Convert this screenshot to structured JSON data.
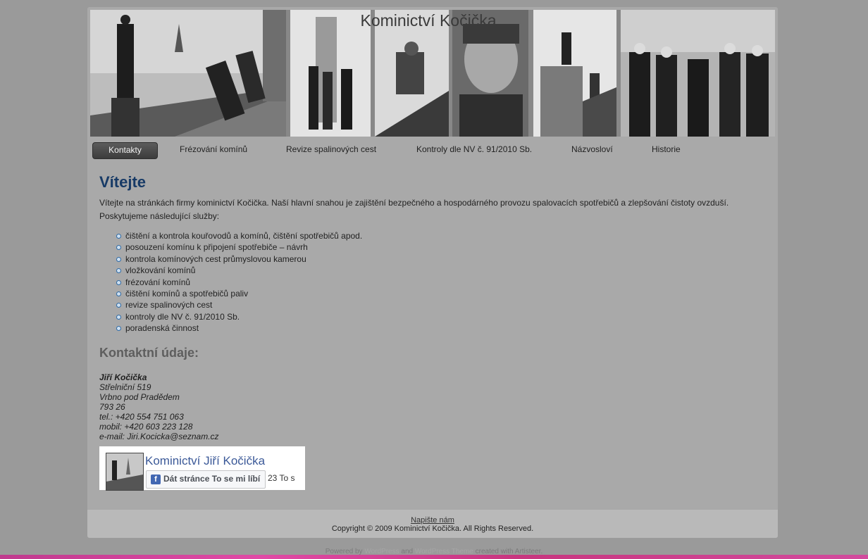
{
  "site": {
    "title": "Kominictví Kočička"
  },
  "nav": {
    "items": [
      {
        "label": "Kontakty",
        "active": true
      },
      {
        "label": "Frézování komínů"
      },
      {
        "label": "Revize spalinových cest"
      },
      {
        "label": "Kontroly dle NV č. 91/2010 Sb."
      },
      {
        "label": "Názvosloví"
      },
      {
        "label": "Historie"
      }
    ]
  },
  "content": {
    "heading": "Vítejte",
    "intro": "Vítejte na stránkách firmy kominictví Kočička. Naší hlavní snahou je zajištění bezpečného a hospodárného provozu spalovacích spotřebičů a zlepšování čistoty ovzduší.",
    "services_intro": "Poskytujeme následující služby:",
    "services": [
      "čištění a kontrola kouřovodů a komínů, čištění spotřebičů apod.",
      "posouzení komínu k připojení spotřebiče – návrh",
      "kontrola komínových cest průmyslovou kamerou",
      "vložkování komínů",
      "frézování komínů",
      "čištění komínů a spotřebičů paliv",
      "revize spalinových cest",
      "kontroly dle NV č. 91/2010 Sb.",
      "poradenská činnost"
    ],
    "contact_heading": "Kontaktní údaje:",
    "contact": {
      "name": "Jiří Kočička",
      "street": "Střelniční 519",
      "city": "Vrbno pod Pradědem",
      "zip": "793 26",
      "phone": "tel.: +420 554 751 063",
      "mobile": "mobil:  +420 603 223 128",
      "email": "e-mail: Jiri.Kocicka@seznam.cz"
    }
  },
  "facebook": {
    "page_name": "Kominictví Jiří Kočička",
    "like_label": "Dát stránce To se mi líbí",
    "like_count": "23 To s"
  },
  "footer": {
    "contact_link": "Napište nám",
    "copyright": "Copyright © 2009 Kominictví Kočička. All Rights Reserved."
  },
  "powered": {
    "prefix": "Powered by",
    "wordpress": "WordPress",
    "and": "and",
    "theme": "WordPress Theme",
    "suffix": "created with Artisteer."
  }
}
